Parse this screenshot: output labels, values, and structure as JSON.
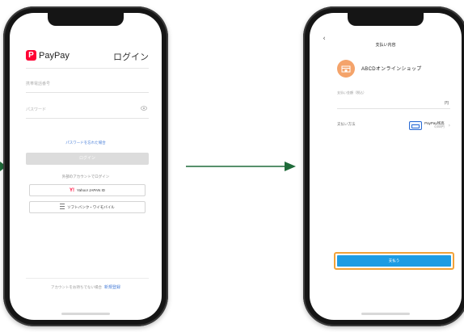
{
  "colors": {
    "accent_red": "#ff0033",
    "link_blue": "#4a7fd8",
    "pay_blue": "#1e9ce3",
    "highlight_orange": "#f2a33a",
    "arrow_green": "#1f6b3a"
  },
  "login_screen": {
    "logo_mark": "P",
    "logo_text": "PayPay",
    "title": "ログイン",
    "phone_placeholder": "携帯電話番号",
    "password_placeholder": "パスワード",
    "forgot_password": "パスワードを忘れた場合",
    "login_button": "ログイン",
    "other_login_label": "外部のアカウントでログイン",
    "yahoo_button": "Yahoo! JAPAN ID",
    "softbank_button": "ソフトバンク・ワイモバイル",
    "footer_text": "アカウントをお持ちでない場合",
    "footer_link": "新規登録"
  },
  "pay_screen": {
    "title": "支払い内容",
    "merchant_name": "ABCDオンラインショップ",
    "amount_label": "支払い金額（税込）",
    "yen_symbol": "円",
    "method_label": "支払い方法",
    "method_name": "PayPay残高",
    "method_balance": "0,000円",
    "pay_button": "支払う"
  }
}
